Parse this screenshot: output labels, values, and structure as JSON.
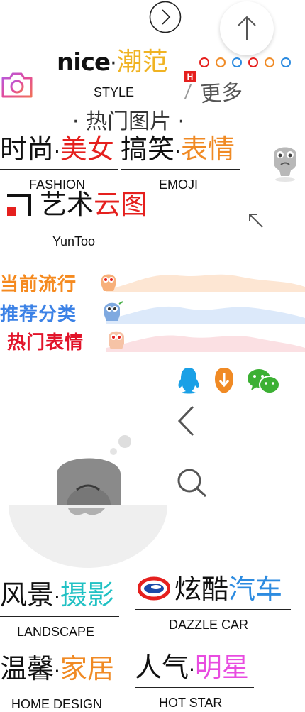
{
  "header": {
    "nice": "nice",
    "sep": "·",
    "chaofan": "潮范",
    "style": "STYLE",
    "hot_badge": "H",
    "more": "更多"
  },
  "hot_pics": {
    "title": "· 热门图片 ·"
  },
  "cat_fashion": {
    "a": "时尚",
    "sep": "·",
    "b": "美女",
    "en": "FASHION"
  },
  "cat_emoji": {
    "a": "搞笑",
    "sep": "·",
    "b": "表情",
    "en": "EMOJI"
  },
  "yuntoo": {
    "a": "艺术",
    "b": "云图",
    "en": "YunToo"
  },
  "tabs": {
    "current": "当前流行",
    "recommend": "推荐分类",
    "hot_emoji": "热门表情"
  },
  "cat_landscape": {
    "a": "风景",
    "sep": "·",
    "b": "摄影",
    "en": "LANDSCAPE"
  },
  "cat_car": {
    "a": "炫酷",
    "b": "汽车",
    "en": "DAZZLE CAR"
  },
  "cat_home": {
    "a": "温馨",
    "sep": "·",
    "b": "家居",
    "en": "HOME DESIGN"
  },
  "cat_star": {
    "a": "人气",
    "sep": "·",
    "b": "明星",
    "en": "HOT STAR"
  },
  "colors": {
    "yellow": "#f0b323",
    "red": "#e5201e",
    "orange": "#f08a24",
    "teal": "#21c1c4",
    "blue": "#2c8be0",
    "pink": "#e84ce0",
    "tab_current": "#f58a1f",
    "tab_recommend": "#3c82e6",
    "tab_hot": "#e2142a"
  }
}
